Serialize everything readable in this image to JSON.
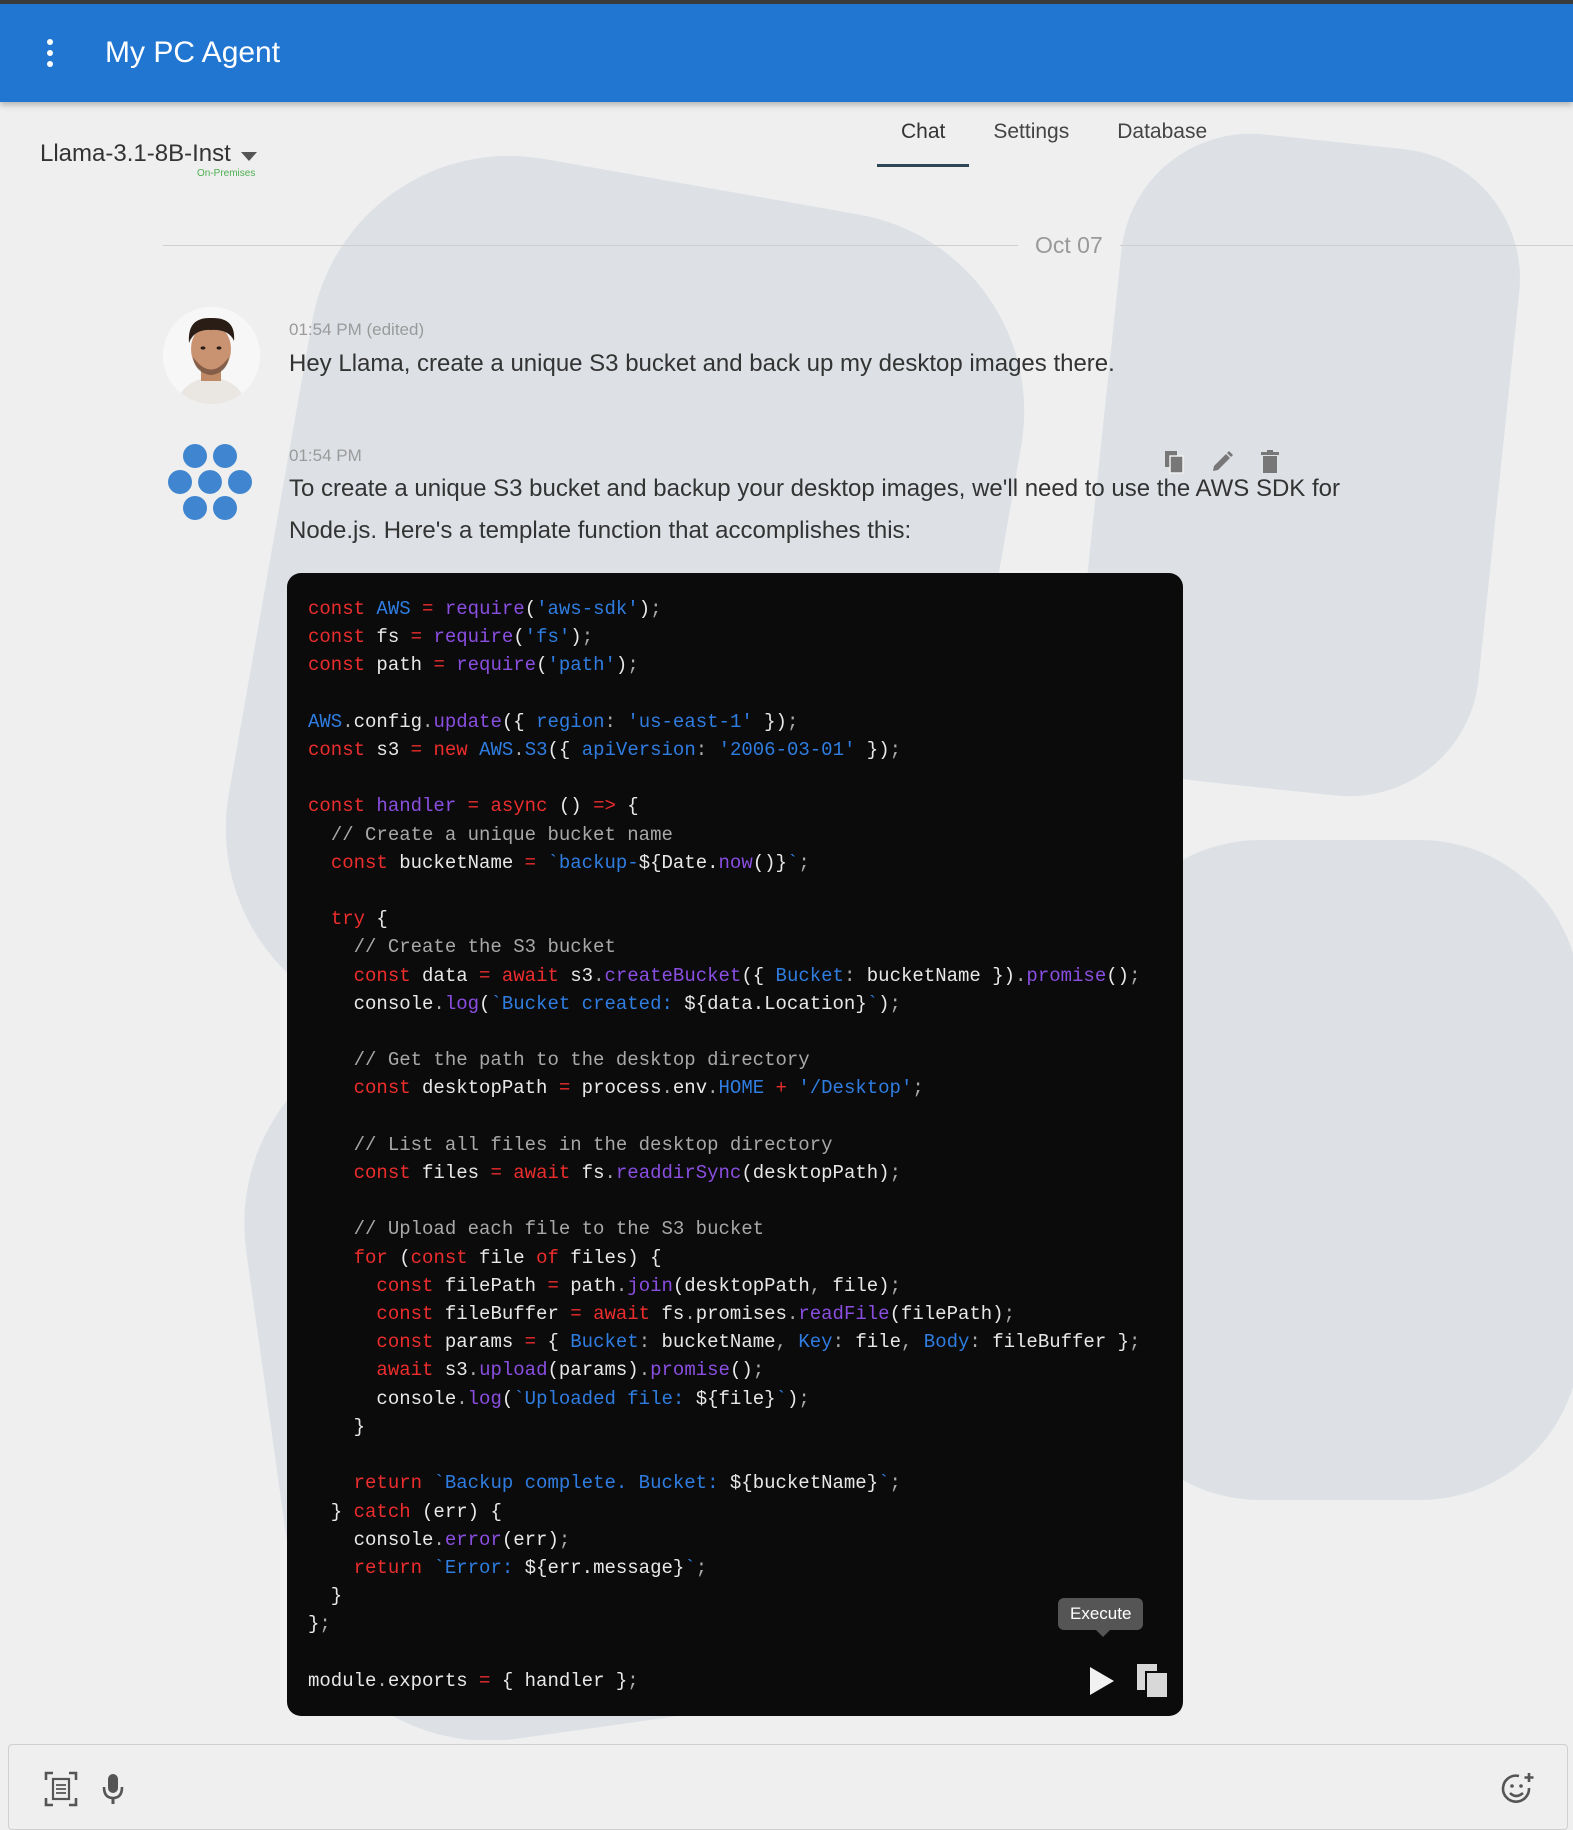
{
  "app": {
    "title": "My PC Agent"
  },
  "model": {
    "name": "Llama-3.1-8B-Inst",
    "subtitle": "On-Premises"
  },
  "tabs": [
    {
      "label": "Chat",
      "active": true
    },
    {
      "label": "Settings",
      "active": false
    },
    {
      "label": "Database",
      "active": false
    }
  ],
  "chat": {
    "date": "Oct 07",
    "user_message": {
      "time": "01:54 PM (edited)",
      "text": "Hey Llama, create a unique S3 bucket and back up my desktop images there."
    },
    "bot_message": {
      "time": "01:54 PM",
      "text_line1": "To create a unique S3 bucket and backup your desktop images, we'll need to use the AWS SDK for",
      "text_line2": "Node.js. Here's a template function that accomplishes this:",
      "code": "const AWS = require('aws-sdk');\nconst fs = require('fs');\nconst path = require('path');\n\nAWS.config.update({ region: 'us-east-1' });\nconst s3 = new AWS.S3({ apiVersion: '2006-03-01' });\n\nconst handler = async () => {\n  // Create a unique bucket name\n  const bucketName = `backup-${Date.now()}`;\n\n  try {\n    // Create the S3 bucket\n    const data = await s3.createBucket({ Bucket: bucketName }).promise();\n    console.log(`Bucket created: ${data.Location}`);\n\n    // Get the path to the desktop directory\n    const desktopPath = process.env.HOME + '/Desktop';\n\n    // List all files in the desktop directory\n    const files = await fs.readdirSync(desktopPath);\n\n    // Upload each file to the S3 bucket\n    for (const file of files) {\n      const filePath = path.join(desktopPath, file);\n      const fileBuffer = await fs.promises.readFile(filePath);\n      const params = { Bucket: bucketName, Key: file, Body: fileBuffer };\n      await s3.upload(params).promise();\n      console.log(`Uploaded file: ${file}`);\n    }\n\n    return `Backup complete. Bucket: ${bucketName}`;\n  } catch (err) {\n    console.error(err);\n    return `Error: ${err.message}`;\n  }\n};\n\nmodule.exports = { handler };",
      "execute_tooltip": "Execute"
    }
  },
  "icons": {
    "menu": "more-vert-icon",
    "copy": "copy-icon",
    "edit": "pencil-icon",
    "delete": "trash-icon",
    "run": "play-icon",
    "screenshot": "screen-capture-icon",
    "mic": "microphone-icon",
    "emoji": "add-emoji-icon"
  },
  "colors": {
    "topbar": "#2176d2",
    "code_bg": "#0b0b0b",
    "keyword": "#ec2d2d",
    "builtin": "#2f7de1",
    "function": "#8a4ee0",
    "comment": "#a8a8a8",
    "logo": "#3f85cf",
    "on_premises": "#4caf50"
  }
}
